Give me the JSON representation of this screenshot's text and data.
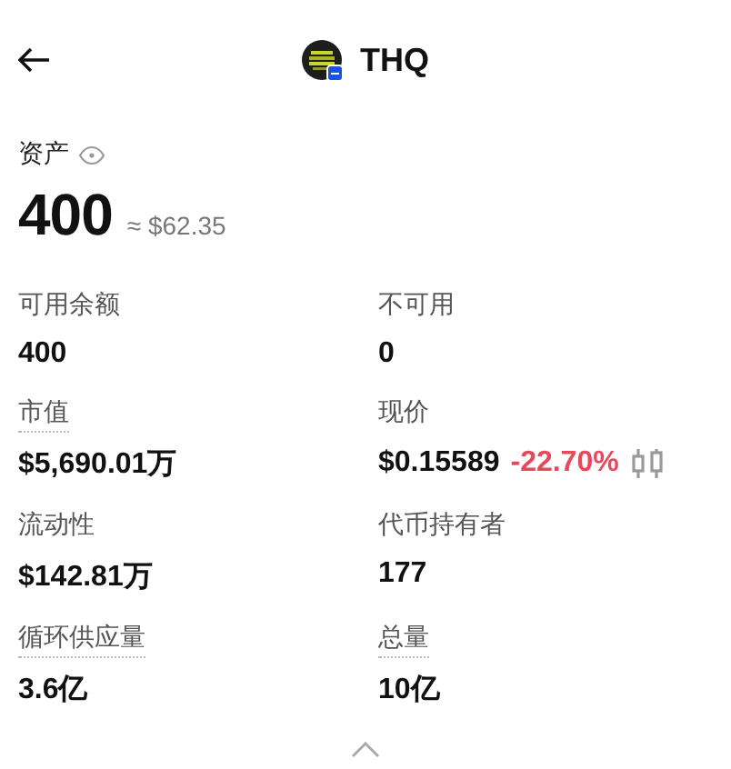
{
  "header": {
    "title": "THQ"
  },
  "assets": {
    "label": "资产",
    "amount": "400",
    "approx": "≈ $62.35"
  },
  "stats": [
    {
      "label": "可用余额",
      "value": "400",
      "dotted": false
    },
    {
      "label": "不可用",
      "value": "0",
      "dotted": false
    },
    {
      "label": "市值",
      "value": "$5,690.01万",
      "dotted": true
    },
    {
      "label": "现价",
      "value": "$0.15589",
      "change": "-22.70%",
      "chart_button": true,
      "dotted": false
    },
    {
      "label": "流动性",
      "value": "$142.81万",
      "dotted": false
    },
    {
      "label": "代币持有者",
      "value": "177",
      "dotted": false
    },
    {
      "label": "循环供应量",
      "value": "3.6亿",
      "dotted": true
    },
    {
      "label": "总量",
      "value": "10亿",
      "dotted": true
    }
  ]
}
